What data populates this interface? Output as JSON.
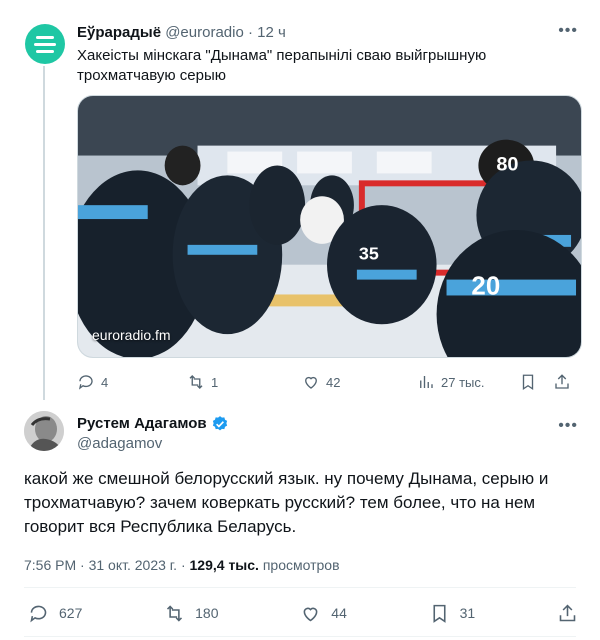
{
  "quoted_tweet": {
    "author_name": "Еўрарадыё",
    "handle": "@euroradio",
    "separator": "·",
    "time": "12 ч",
    "text": "Хакеісты мінскага \"Дынама\" перапынілі сваю выйгрышную трохматчавую серыю",
    "media_caption": "euroradio.fm",
    "avatar_color": "#1fc7a4",
    "actions": {
      "replies": "4",
      "reposts": "1",
      "likes": "42",
      "views": "27 тыс."
    }
  },
  "main_tweet": {
    "author_name": "Рустем Адагамов",
    "handle": "@adagamov",
    "text": "какой же смешной белорусский язык. ну почему Дынама, серыю и трохматчавую? зачем коверкать русский? тем более, что на нем говорит вся Республика Беларусь.",
    "timestamp": "7:56 PM · 31 окт. 2023 г. · ",
    "views_count": "129,4 тыс.",
    "views_label": "просмотров",
    "actions": {
      "replies": "627",
      "reposts": "180",
      "likes": "44",
      "bookmarks": "31"
    }
  },
  "colors": {
    "text_primary": "#0f1419",
    "text_secondary": "#536471",
    "verified_blue": "#1d9bf0",
    "divider": "#eff3f4"
  },
  "icons": [
    "more-icon",
    "reply-icon",
    "repost-icon",
    "like-icon",
    "views-icon",
    "bookmark-icon",
    "share-icon",
    "verified-icon"
  ]
}
